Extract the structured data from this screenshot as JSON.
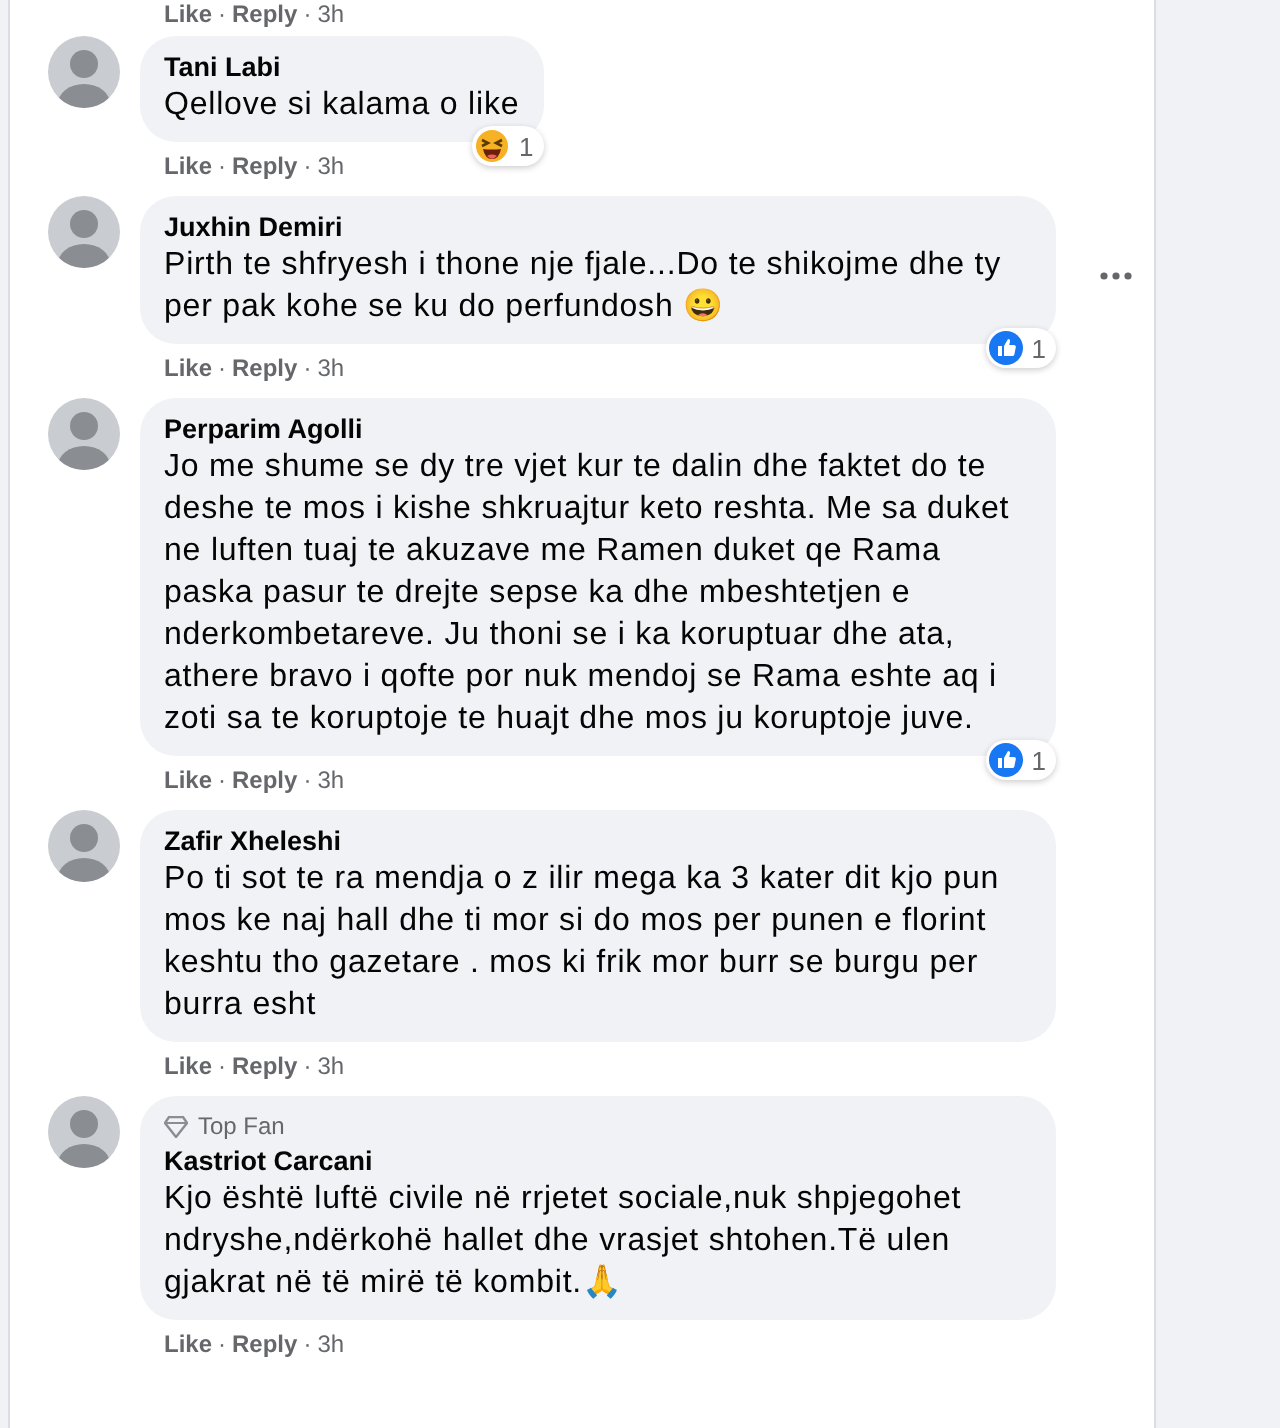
{
  "top_actions": {
    "like": "Like",
    "separator": "·",
    "reply": "Reply",
    "time": "3h"
  },
  "comments": [
    {
      "author": "Tani Labi",
      "text": "Qellove si kalama o like",
      "like": "Like",
      "separator": "·",
      "reply": "Reply",
      "time": "3h",
      "reaction": {
        "kind": "haha",
        "count": "1"
      },
      "more_menu": false
    },
    {
      "author": "Juxhin Demiri",
      "text": "Pirth te shfryesh i thone nje fjale...Do te shikojme dhe ty per pak kohe se ku do perfundosh 😀",
      "like": "Like",
      "separator": "·",
      "reply": "Reply",
      "time": "3h",
      "reaction": {
        "kind": "like",
        "count": "1"
      },
      "more_menu": true
    },
    {
      "author": "Perparim Agolli",
      "text": "Jo me shume se dy tre vjet kur te dalin dhe faktet do te deshe te mos i kishe shkruajtur keto reshta. Me sa duket ne luften tuaj te akuzave me Ramen duket qe Rama paska pasur te drejte sepse ka dhe mbeshtetjen e nderkombetareve. Ju thoni se i ka koruptuar dhe ata, athere bravo i qofte por nuk mendoj se Rama eshte aq i zoti sa te koruptoje te huajt dhe mos ju koruptoje juve.",
      "like": "Like",
      "separator": "·",
      "reply": "Reply",
      "time": "3h",
      "reaction": {
        "kind": "like",
        "count": "1"
      },
      "more_menu": false
    },
    {
      "author": "Zafir Xheleshi",
      "text": "Po ti sot te ra mendja o z ilir mega ka 3 kater dit kjo pun mos ke naj hall dhe ti mor si do mos per punen e florint keshtu tho gazetare . mos ki frik mor burr se burgu per burra esht",
      "like": "Like",
      "separator": "·",
      "reply": "Reply",
      "time": "3h",
      "more_menu": false
    },
    {
      "author": "Kastriot Carcani",
      "badge": "Top Fan",
      "text": "Kjo është luftë civile në rrjetet sociale,nuk shpjegohet ndryshe,ndërkohë hallet dhe vrasjet shtohen.Të ulen gjakrat në të mirë të kombit.🙏",
      "like": "Like",
      "separator": "·",
      "reply": "Reply",
      "time": "3h",
      "more_menu": false
    }
  ]
}
